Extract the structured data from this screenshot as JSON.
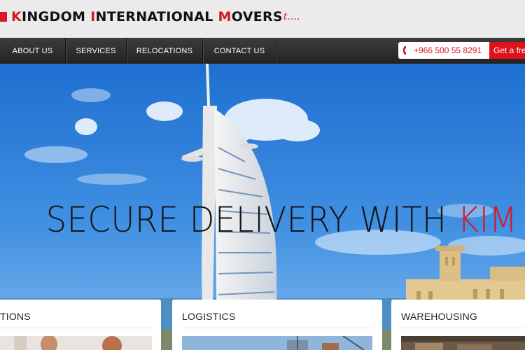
{
  "logo": {
    "text": "Kingdom International Movers",
    "tag": "t...."
  },
  "nav": {
    "items": [
      {
        "label": "ABOUT US"
      },
      {
        "label": "SERVICES"
      },
      {
        "label": "RELOCATIONS"
      },
      {
        "label": "CONTACT US"
      }
    ],
    "phone": "+966 500 55 8291",
    "quote_label": "Get a fre"
  },
  "hero": {
    "title_main": "SECURE DELIVERY WITH ",
    "title_accent": "KIM"
  },
  "cards": [
    {
      "title": "TIONS"
    },
    {
      "title": "LOGISTICS"
    },
    {
      "title": "WAREHOUSING"
    }
  ],
  "colors": {
    "brand_red": "#d31b27",
    "nav_dark": "#2b2b2b",
    "sky": "#2f7fd8"
  },
  "icons": {
    "phone": "phone-icon",
    "house": "house-icon"
  }
}
